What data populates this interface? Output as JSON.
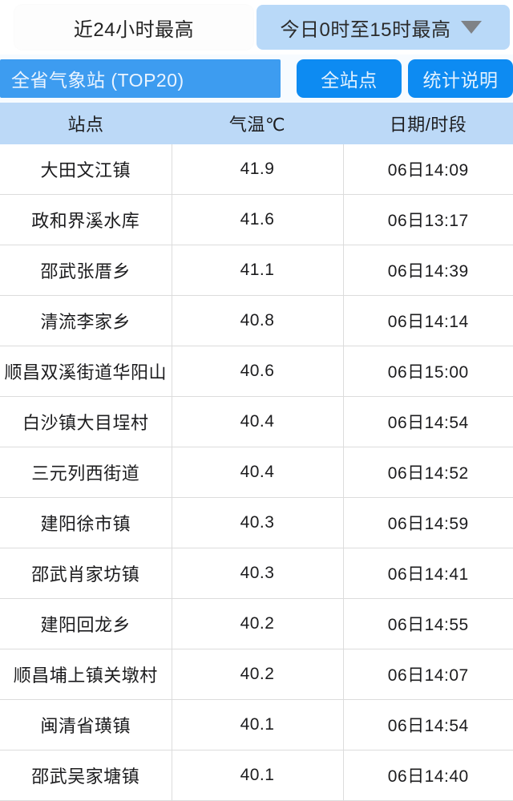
{
  "tabs": [
    {
      "label": "近24小时最高",
      "active": false,
      "has_caret": false
    },
    {
      "label": "今日0时至15时最高",
      "active": true,
      "has_caret": true
    }
  ],
  "action_row": {
    "title": "全省气象站 (TOP20)",
    "all_stations_label": "全站点",
    "stats_note_label": "统计说明"
  },
  "table": {
    "headers": [
      "站点",
      "气温℃",
      "日期/时段"
    ],
    "rows": [
      {
        "station": "大田文江镇",
        "temp": "41.9",
        "datetime": "06日14:09"
      },
      {
        "station": "政和界溪水库",
        "temp": "41.6",
        "datetime": "06日13:17"
      },
      {
        "station": "邵武张厝乡",
        "temp": "41.1",
        "datetime": "06日14:39"
      },
      {
        "station": "清流李家乡",
        "temp": "40.8",
        "datetime": "06日14:14"
      },
      {
        "station": "顺昌双溪街道华阳山",
        "temp": "40.6",
        "datetime": "06日15:00"
      },
      {
        "station": "白沙镇大目埕村",
        "temp": "40.4",
        "datetime": "06日14:54"
      },
      {
        "station": "三元列西街道",
        "temp": "40.4",
        "datetime": "06日14:52"
      },
      {
        "station": "建阳徐市镇",
        "temp": "40.3",
        "datetime": "06日14:59"
      },
      {
        "station": "邵武肖家坊镇",
        "temp": "40.3",
        "datetime": "06日14:41"
      },
      {
        "station": "建阳回龙乡",
        "temp": "40.2",
        "datetime": "06日14:55"
      },
      {
        "station": "顺昌埔上镇关墩村",
        "temp": "40.2",
        "datetime": "06日14:07"
      },
      {
        "station": "闽清省璜镇",
        "temp": "40.1",
        "datetime": "06日14:54"
      },
      {
        "station": "邵武吴家塘镇",
        "temp": "40.1",
        "datetime": "06日14:40"
      }
    ]
  },
  "colors": {
    "tab_active_bg": "#b9d9f8",
    "title_bar_bg": "#3d9cf0",
    "button_bg": "#0d8bf2",
    "table_header_bg": "#bcd9f7",
    "row_border": "#dcdcdc"
  }
}
